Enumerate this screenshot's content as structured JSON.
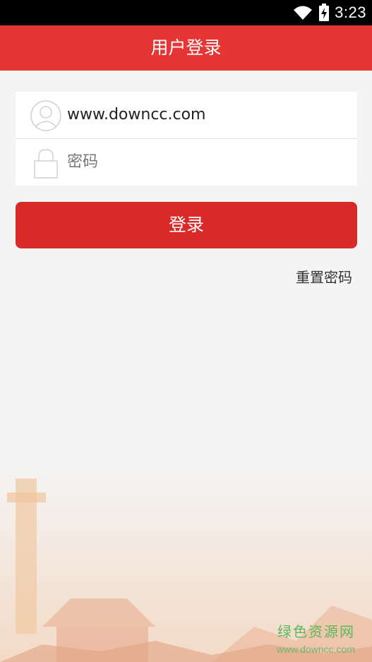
{
  "status_bar": {
    "time": "3:23",
    "wifi_icon": "wifi-icon",
    "battery_icon": "battery-charging-icon"
  },
  "header": {
    "title": "用户登录"
  },
  "form": {
    "username_value": "www.downcc.com",
    "password_placeholder": "密码",
    "user_icon": "user-avatar-icon",
    "lock_icon": "lock-icon"
  },
  "actions": {
    "login_label": "登录",
    "reset_password_label": "重置密码"
  },
  "watermark": {
    "title": "绿色资源网",
    "url": "www.downcc.com"
  },
  "colors": {
    "accent": "#e53535",
    "button": "#d92a2a",
    "background": "#f4f4f4",
    "watermark": "#5cb85c"
  }
}
